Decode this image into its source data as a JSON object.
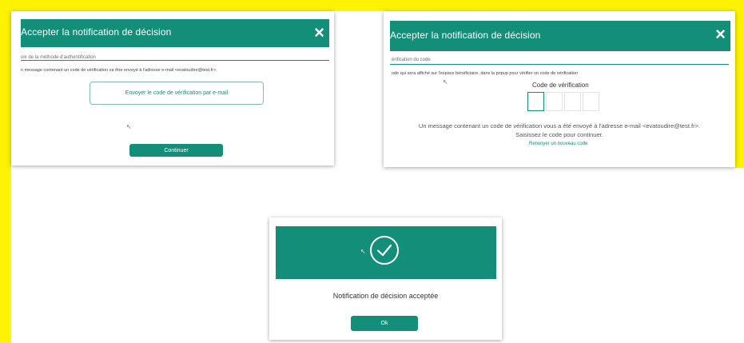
{
  "colors": {
    "brand": "#138e79",
    "frame": "#fdf200"
  },
  "step1": {
    "title": "Accepter la notification de décision",
    "section_label": "oix de la méthode d'authentification",
    "info": "n message contenant un code de vérification va être envoyé à l'adresse e-mail <evatoudire@test.fr>.",
    "send_email_label": "Envoyer le code de vérification par e-mail",
    "continue_label": "Continuer",
    "close_icon": "×"
  },
  "step2": {
    "title": "Accepter la notification de décision",
    "section_label": "érification du code",
    "info": "ode qui sera affiché sur l'espace bénéficiaire, dans la popup pour vérifier un code de vérification",
    "code_label": "Code de vérification",
    "message_line1": "Un message contenant un code de vérification vous a été envoyé à l'adresse e-mail <evatoudire@test.fr>.",
    "message_line2": "Saisissez le code pour continuer.",
    "resend_label": "Renvoyer un nouveau code",
    "close_icon": "×"
  },
  "step3": {
    "success_text": "Notification de décision acceptée",
    "ok_label": "Ok"
  }
}
